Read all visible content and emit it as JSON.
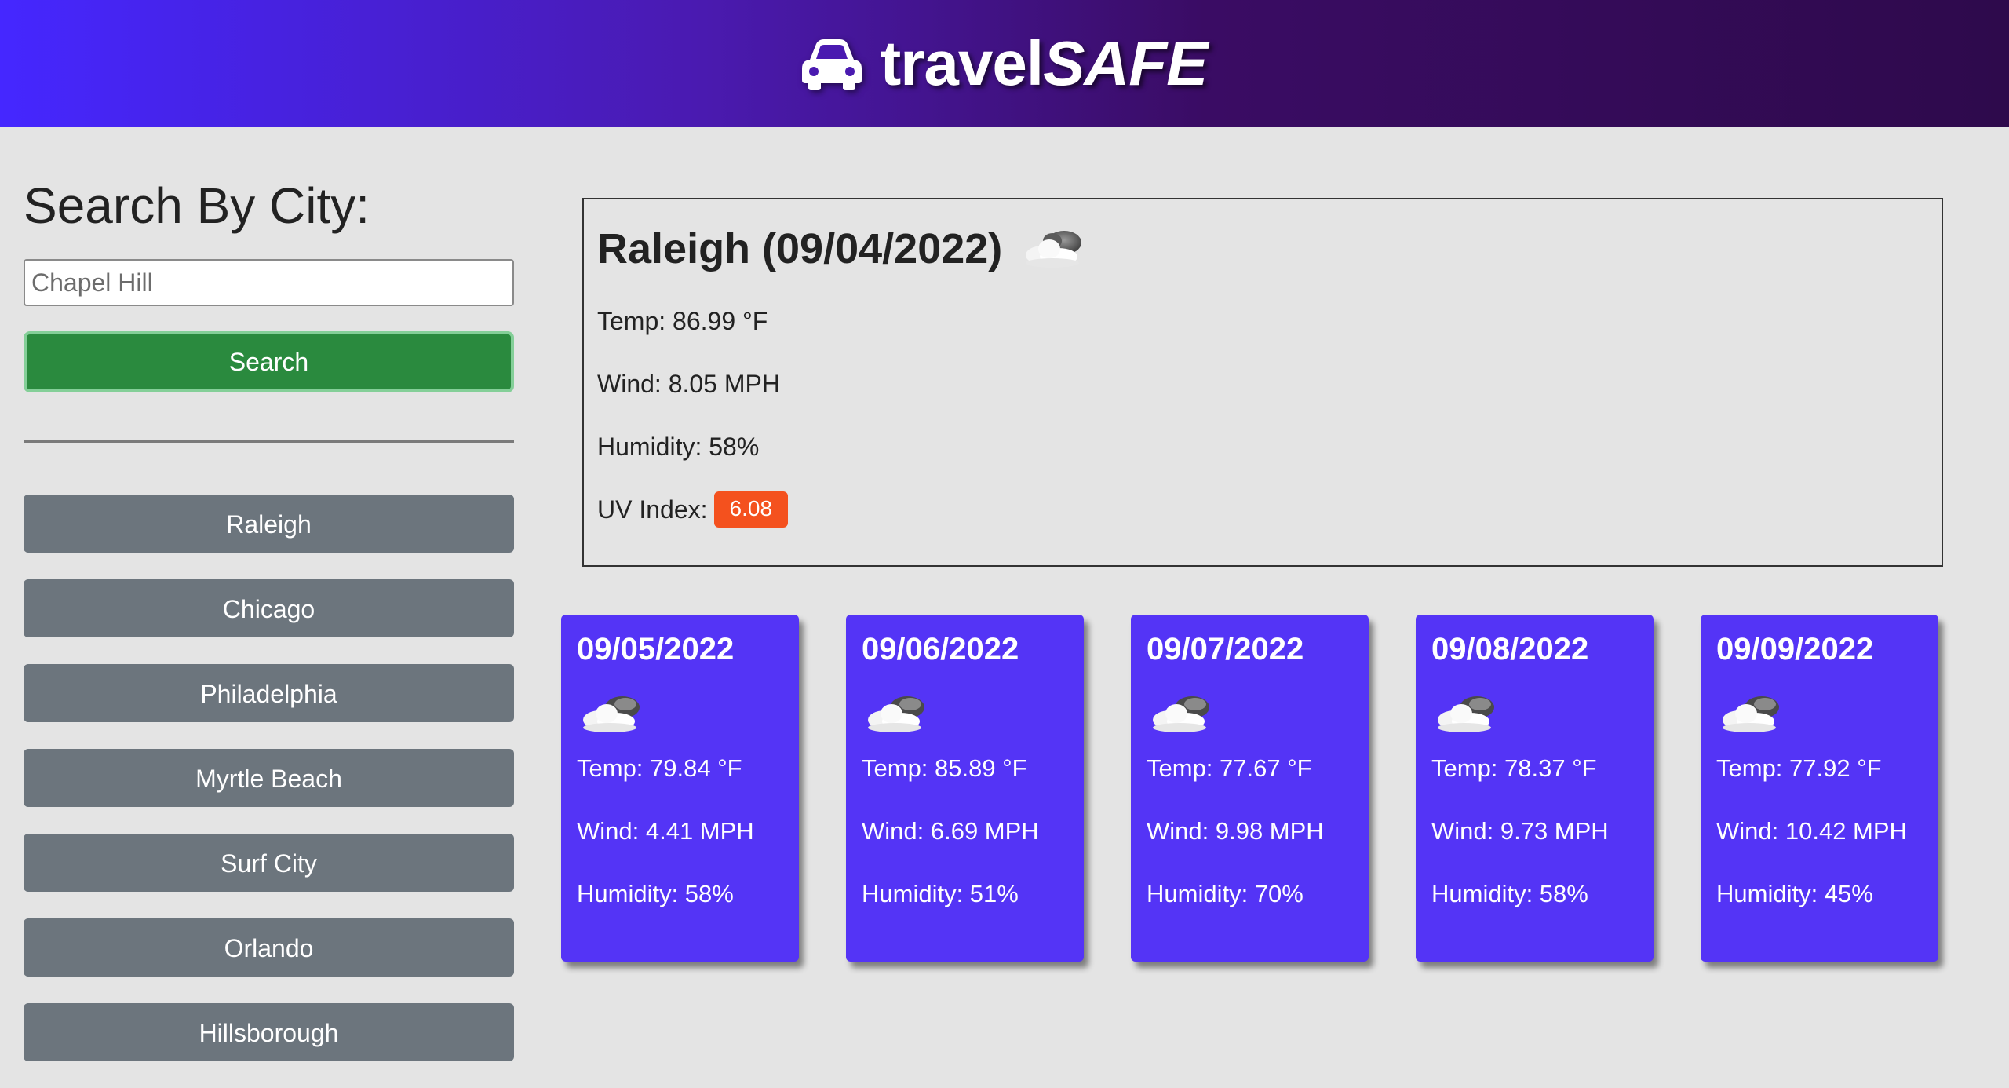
{
  "header": {
    "brand_part1": "travel",
    "brand_part2": "SAFE",
    "logo_icon": "car-icon"
  },
  "sidebar": {
    "title": "Search By City:",
    "search_value": "",
    "search_placeholder": "Chapel Hill",
    "search_button": "Search",
    "history": [
      "Raleigh",
      "Chicago",
      "Philadelphia",
      "Myrtle Beach",
      "Surf City",
      "Orlando",
      "Hillsborough"
    ]
  },
  "current": {
    "title": "Raleigh (09/04/2022)",
    "icon": "partly-cloudy-icon",
    "temp": "Temp: 86.99 °F",
    "wind": "Wind: 8.05 MPH",
    "humidity": "Humidity: 58%",
    "uv_label": "UV Index:",
    "uv_value": "6.08"
  },
  "forecast": [
    {
      "date": "09/05/2022",
      "temp": "Temp: 79.84 °F",
      "wind": "Wind: 4.41 MPH",
      "humidity": "Humidity: 58%"
    },
    {
      "date": "09/06/2022",
      "temp": "Temp: 85.89 °F",
      "wind": "Wind: 6.69 MPH",
      "humidity": "Humidity: 51%"
    },
    {
      "date": "09/07/2022",
      "temp": "Temp: 77.67 °F",
      "wind": "Wind: 9.98 MPH",
      "humidity": "Humidity: 70%"
    },
    {
      "date": "09/08/2022",
      "temp": "Temp: 78.37 °F",
      "wind": "Wind: 9.73 MPH",
      "humidity": "Humidity: 58%"
    },
    {
      "date": "09/09/2022",
      "temp": "Temp: 77.92 °F",
      "wind": "Wind: 10.42 MPH",
      "humidity": "Humidity: 45%"
    }
  ],
  "colors": {
    "header_gradient_start": "#4527ff",
    "header_gradient_end": "#2e0a4c",
    "search_button": "#2a8a3e",
    "history_button": "#6c757d",
    "uv_badge": "#f4511e",
    "forecast_card": "#5434f6"
  }
}
